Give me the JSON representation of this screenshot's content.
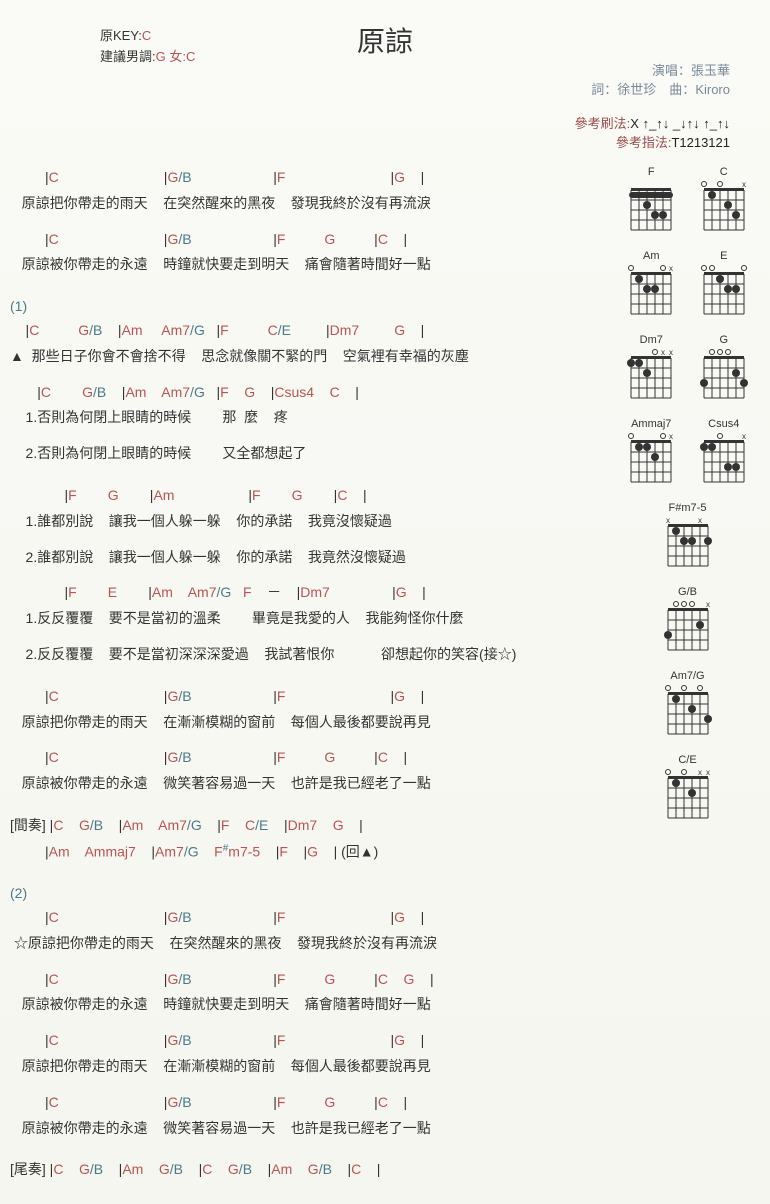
{
  "title": "原諒",
  "key_label": "原KEY:",
  "key_value": "C",
  "suggest_label": "建議男調:",
  "suggest_value": "G 女:C",
  "singer_label": "演唱：",
  "singer": "張玉華",
  "lyricist_label": "詞：",
  "lyricist": "徐世珍",
  "composer_label": "曲：",
  "composer": "Kiroro",
  "strum_label": "參考刷法:",
  "strum": "X ↑_↑↓ _↓↑↓ ↑_↑↓",
  "finger_label": "參考指法:",
  "finger": "T1213121",
  "s1_mark": "(1)",
  "s2_mark": "(2)",
  "interlude": "[間奏]",
  "outro": "[尾奏]",
  "back": "| (回▲)",
  "tri": "▲",
  "star": "☆",
  "connect": "(接☆)",
  "dash": "－",
  "lines": {
    "v1l1": "   原諒把你帶走的雨天    在突然醒來的黑夜    發現我終於沒有再流淚",
    "v1l2": "   原諒被你帶走的永遠    時鐘就快要走到明天    痛會隨著時間好一點",
    "p1": "  那些日子你會不會捨不得    思念就像關不緊的門    空氣裡有幸福的灰塵",
    "alt1a": "    1.否則為何閉上眼睛的時候        那  麼    疼",
    "alt1b": "    2.否則為何閉上眼睛的時候        又全都想起了",
    "ch1a": "    1.誰都別說    讓我一個人躲一躲    你的承諾    我竟沒懷疑過",
    "ch1b": "    2.誰都別說    讓我一個人躲一躲    你的承諾    我竟然沒懷疑過",
    "ch2a": "    1.反反覆覆    要不是當初的溫柔        畢竟是我愛的人    我能夠怪你什麼",
    "ch2b": "    2.反反覆覆    要不是當初深深深愛過    我試著恨你            卻想起你的笑容",
    "v2l1": "   原諒把你帶走的雨天    在漸漸模糊的窗前    每個人最後都要說再見",
    "v2l2": "   原諒被你帶走的永遠    微笑著容易過一天    也許是我已經老了一點",
    "v3l1": " ☆原諒把你帶走的雨天    在突然醒來的黑夜    發現我終於沒有再流淚",
    "v3l2": "   原諒被你帶走的永遠    時鐘就快要走到明天    痛會隨著時間好一點",
    "v4l1": "   原諒把你帶走的雨天    在漸漸模糊的窗前    每個人最後都要說再見",
    "v4l2": "   原諒被你帶走的永遠    微笑著容易過一天    也許是我已經老了一點"
  },
  "diagrams": {
    "row1": [
      "F",
      "C"
    ],
    "row2": [
      "Am",
      "E"
    ],
    "row3": [
      "Dm7",
      "G"
    ],
    "row4": [
      "Ammaj7",
      "Csus4"
    ],
    "row5": [
      "F#m7-5"
    ],
    "row6": [
      "G/B"
    ],
    "row7": [
      "Am7/G"
    ],
    "row8": [
      "C/E"
    ]
  }
}
